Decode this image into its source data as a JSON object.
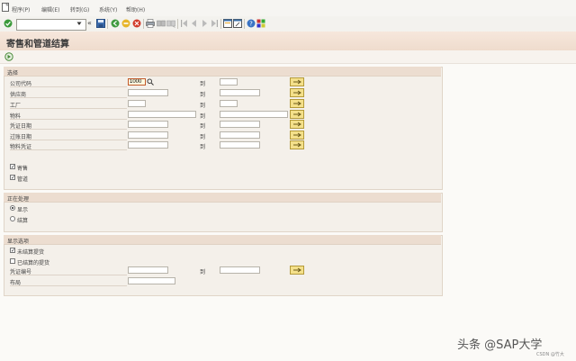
{
  "menubar": {
    "items": [
      {
        "label": "程序(P)"
      },
      {
        "label": "编辑(E)"
      },
      {
        "label": "转到(G)"
      },
      {
        "label": "系统(Y)"
      },
      {
        "label": "帮助(H)"
      }
    ]
  },
  "toolbar": {
    "command_value": "",
    "nav_back_symbol": "«"
  },
  "page": {
    "title": "寄售和管道结算"
  },
  "selection": {
    "title": "选择",
    "to_label": "到",
    "rows": [
      {
        "label": "公司代码",
        "from_value": "1000",
        "to_value": ""
      },
      {
        "label": "供应商",
        "from_value": "",
        "to_value": ""
      },
      {
        "label": "工厂",
        "from_value": "",
        "to_value": ""
      },
      {
        "label": "物料",
        "from_value": "",
        "to_value": ""
      },
      {
        "label": "凭证日期",
        "from_value": "",
        "to_value": ""
      },
      {
        "label": "过账日期",
        "from_value": "",
        "to_value": ""
      },
      {
        "label": "物料凭证",
        "from_value": "",
        "to_value": ""
      }
    ],
    "checkboxes": [
      {
        "label": "寄售",
        "checked": true
      },
      {
        "label": "管道",
        "checked": true
      }
    ]
  },
  "processing": {
    "title": "正在处理",
    "options": [
      {
        "label": "显示",
        "selected": true
      },
      {
        "label": "结算",
        "selected": false
      }
    ]
  },
  "display": {
    "title": "显示选项",
    "checkboxes": [
      {
        "label": "未结算提货",
        "checked": true
      },
      {
        "label": "已结算的提货",
        "checked": false
      }
    ],
    "doc_number_label": "凭证编号",
    "to_label": "到",
    "layout_label": "布局"
  },
  "watermark": {
    "text": "头条 @SAP大学",
    "sub": "CSDN @竹大"
  },
  "colors": {
    "title_band": "#efdccd",
    "group_head": "#ecddd0",
    "multi_button": "#f4e08a"
  }
}
